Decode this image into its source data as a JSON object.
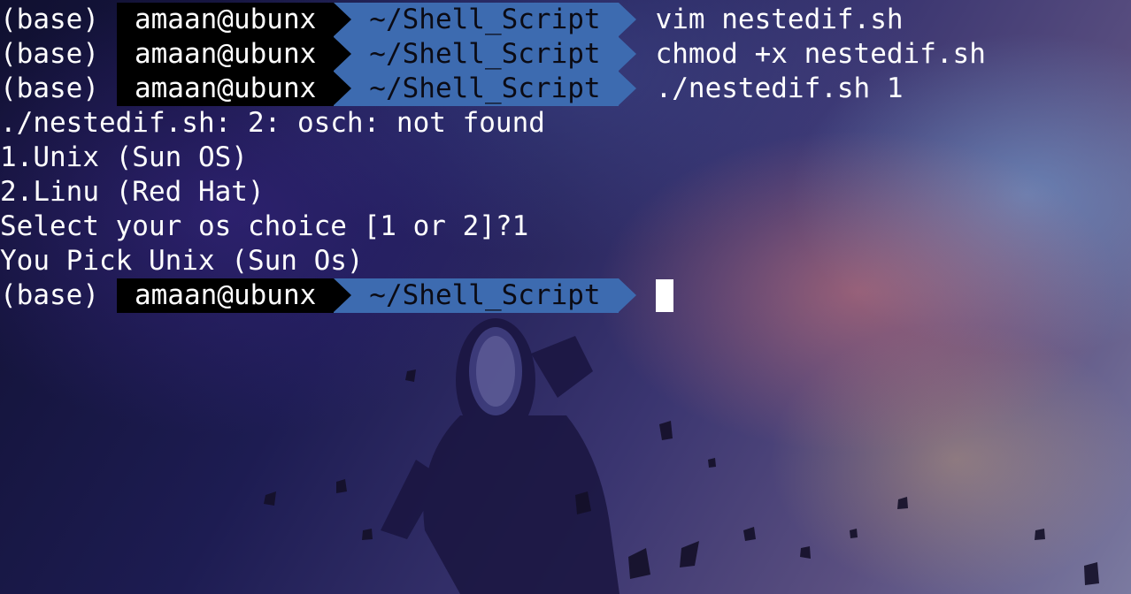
{
  "terminal": {
    "prompt": {
      "env": "(base)",
      "user_host": "amaan@ubunx",
      "cwd": "~/Shell_Script"
    },
    "commands": [
      "vim nestedif.sh",
      "chmod +x nestedif.sh",
      "./nestedif.sh 1"
    ],
    "output": [
      "./nestedif.sh: 2: osch: not found",
      "1.Unix (Sun OS)",
      "2.Linu (Red Hat)",
      "Select your os choice [1 or 2]?1",
      "You Pick Unix (Sun Os)"
    ]
  },
  "colors": {
    "prompt_user_bg": "#000000",
    "prompt_dir_bg": "#3d6bb0",
    "prompt_dir_fg": "#0b0b14",
    "text": "#ffffff"
  }
}
